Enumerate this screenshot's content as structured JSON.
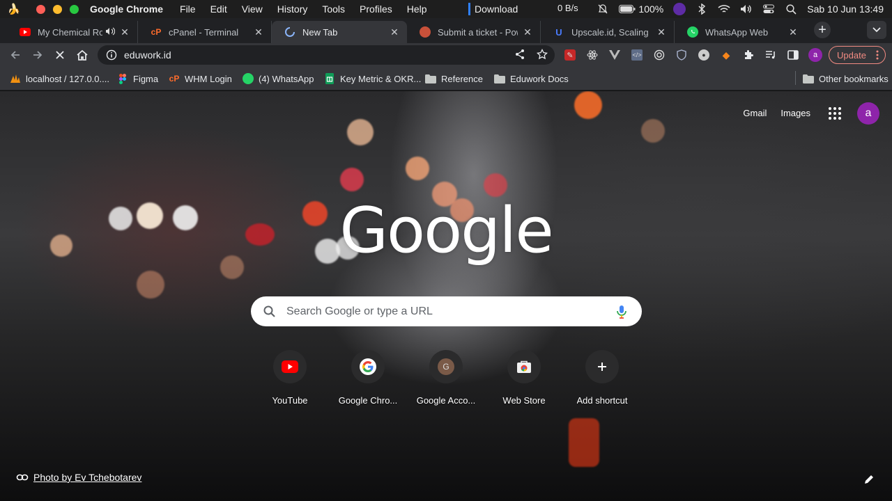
{
  "menubar": {
    "app_name": "Google Chrome",
    "items": [
      "File",
      "Edit",
      "View",
      "History",
      "Tools",
      "Profiles",
      "Help"
    ],
    "download_label": "Download",
    "net_speed": "0 B/s",
    "battery": "100%",
    "clock": "Sab 10 Jun 13:49"
  },
  "tabs": [
    {
      "title": "My Chemical Romance",
      "icon": "youtube-icon",
      "audio": true
    },
    {
      "title": "cPanel - Terminal",
      "icon": "cpanel-icon"
    },
    {
      "title": "New Tab",
      "icon": "loading-spinner-icon",
      "active": true
    },
    {
      "title": "Submit a ticket - PowerDNS",
      "icon": "ticket-site-icon"
    },
    {
      "title": "Upscale.id, Scaling Up",
      "icon": "upscale-icon"
    },
    {
      "title": "WhatsApp Web",
      "icon": "whatsapp-icon"
    }
  ],
  "toolbar": {
    "url": "eduwork.id",
    "profile_initial": "a",
    "update_label": "Update"
  },
  "bookmarks": [
    {
      "label": "localhost / 127.0.0....",
      "icon": "phpmyadmin-icon"
    },
    {
      "label": "Figma",
      "icon": "figma-icon"
    },
    {
      "label": "WHM Login",
      "icon": "cpanel-icon"
    },
    {
      "label": "(4) WhatsApp",
      "icon": "whatsapp-icon"
    },
    {
      "label": "Key Metric & OKR...",
      "icon": "sheets-icon"
    },
    {
      "label": "Reference",
      "icon": "folder-icon"
    },
    {
      "label": "Eduwork Docs",
      "icon": "folder-icon"
    }
  ],
  "other_bookmarks": "Other bookmarks",
  "newtab": {
    "gmail": "Gmail",
    "images": "Images",
    "avatar_initial": "a",
    "logo": "Google",
    "search_placeholder": "Search Google or type a URL",
    "shortcuts": [
      {
        "label": "YouTube",
        "icon": "youtube-icon"
      },
      {
        "label": "Google Chro...",
        "icon": "google-g-icon"
      },
      {
        "label": "Google Acco...",
        "icon": "account-g-icon"
      },
      {
        "label": "Web Store",
        "icon": "webstore-icon"
      },
      {
        "label": "Add shortcut",
        "icon": "plus-icon"
      }
    ],
    "attribution": "Photo by Ev Tchebotarev"
  },
  "colors": {
    "brand_purple": "#8e24aa",
    "update_red": "#f28b82",
    "toolbar_bg": "#35363a",
    "tabstrip_bg": "#202124"
  }
}
